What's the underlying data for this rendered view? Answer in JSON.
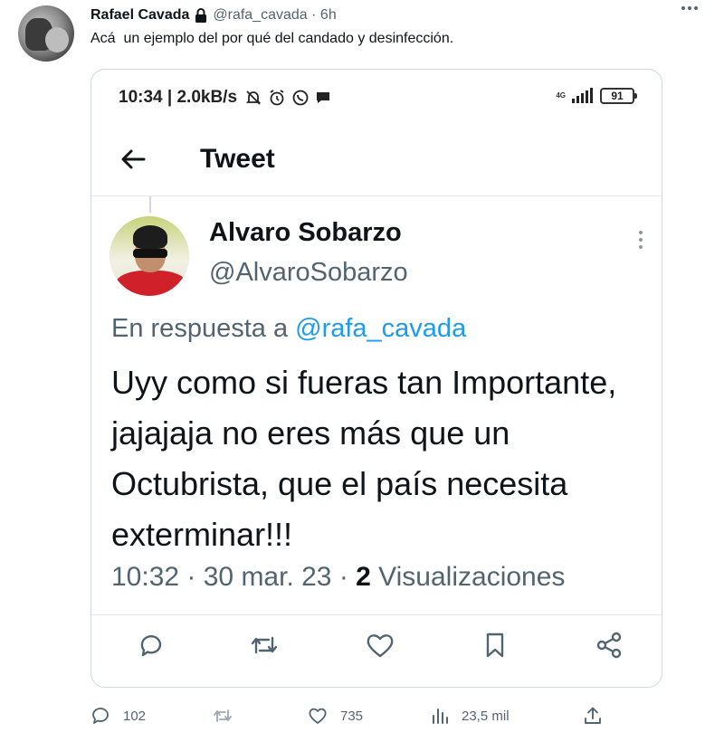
{
  "tweet": {
    "author_name": "Rafael Cavada",
    "handle_time": "@rafa_cavada · 6h",
    "text": "Acá  un ejemplo del por qué del candado y desinfección."
  },
  "screenshot": {
    "status_time": "10:34 | 2.0kB/s",
    "network_label": "4G",
    "battery": "91",
    "nav_title": "Tweet",
    "quoted": {
      "author_name": "Alvaro Sobarzo",
      "author_handle": "@AlvaroSobarzo",
      "reply_prefix": "En respuesta a",
      "reply_handle": "@rafa_cavada",
      "text": "Uyy como si fueras tan Importante, jajajaja no eres más que un Octubrista, que el país necesita exterminar!!!",
      "time_date": "10:32 · 30 mar. 23 · ",
      "views_count": "2",
      "views_label": " Visualizaciones"
    }
  },
  "actions": {
    "reply_count": "102",
    "retweet_count": "",
    "like_count": "735",
    "view_count": "23,5 mil"
  },
  "icons": {
    "lock": "lock-icon",
    "more": "more-horizontal-icon",
    "reply": "reply-icon",
    "retweet": "retweet-icon",
    "like": "heart-icon",
    "views": "bar-chart-icon",
    "share": "share-icon"
  }
}
